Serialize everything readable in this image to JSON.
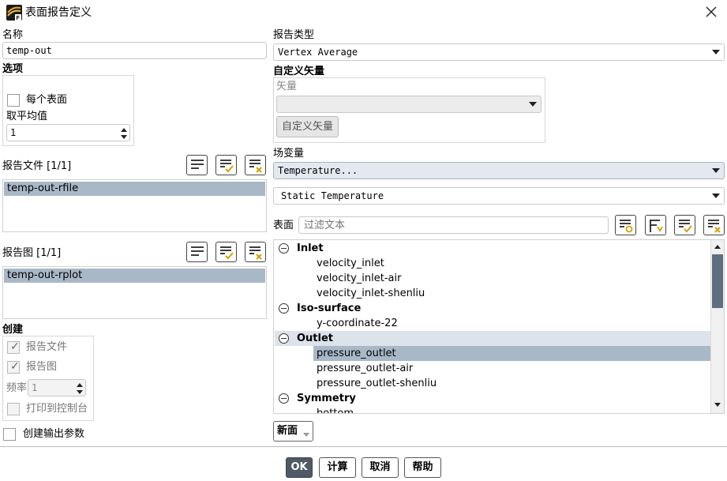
{
  "window": {
    "title": "表面报告定义",
    "close_icon": "close-icon",
    "app_icon": "fluent-icon"
  },
  "name": {
    "label": "名称",
    "value": "temp-out"
  },
  "options": {
    "label": "选项",
    "per_surface_label": "每个表面",
    "per_surface_checked": false,
    "average_over_label": "取平均值",
    "average_over_value": "1"
  },
  "report_files": {
    "label": "报告文件 [1/1]",
    "items": [
      "temp-out-rfile"
    ],
    "selected_index": 0
  },
  "report_plots": {
    "label": "报告图 [1/1]",
    "items": [
      "temp-out-rplot"
    ],
    "selected_index": 0
  },
  "create": {
    "label": "创建",
    "report_file_label": "报告文件",
    "report_file_checked": true,
    "report_plot_label": "报告图",
    "report_plot_checked": true,
    "frequency_label": "频率",
    "frequency_value": "1",
    "print_console_label": "打印到控制台",
    "print_console_checked": false
  },
  "create_output_param": {
    "label": "创建输出参数",
    "checked": false
  },
  "report_type": {
    "label": "报告类型",
    "value": "Vertex Average"
  },
  "custom_vector": {
    "label": "自定义矢量",
    "vector_label": "矢量",
    "vector_value": "",
    "button_label": "自定义矢量"
  },
  "field_variable": {
    "label": "场变量",
    "category": "Temperature...",
    "variable": "Static Temperature"
  },
  "surfaces": {
    "label": "表面",
    "filter_placeholder": "过滤文本",
    "tree": [
      {
        "type": "group",
        "label": "Inlet"
      },
      {
        "type": "item",
        "label": "velocity_inlet"
      },
      {
        "type": "item",
        "label": "velocity_inlet-air"
      },
      {
        "type": "item",
        "label": "velocity_inlet-shenliu"
      },
      {
        "type": "group",
        "label": "Iso-surface"
      },
      {
        "type": "item",
        "label": "y-coordinate-22"
      },
      {
        "type": "group",
        "label": "Outlet",
        "highlighted": true
      },
      {
        "type": "item",
        "label": "pressure_outlet",
        "selected": true
      },
      {
        "type": "item",
        "label": "pressure_outlet-air"
      },
      {
        "type": "item",
        "label": "pressure_outlet-shenliu"
      },
      {
        "type": "group",
        "label": "Symmetry"
      },
      {
        "type": "item",
        "label": "bottom"
      }
    ]
  },
  "new_button": {
    "label": "新面"
  },
  "footer": {
    "ok": "OK",
    "compute": "计算",
    "cancel": "取消",
    "help": "帮助"
  },
  "colors": {
    "selection": "#a9b8c7",
    "ok_button": "#4f5a66",
    "tree_highlight": "#dde3ea",
    "scrollbar_thumb": "#5f6f80"
  }
}
